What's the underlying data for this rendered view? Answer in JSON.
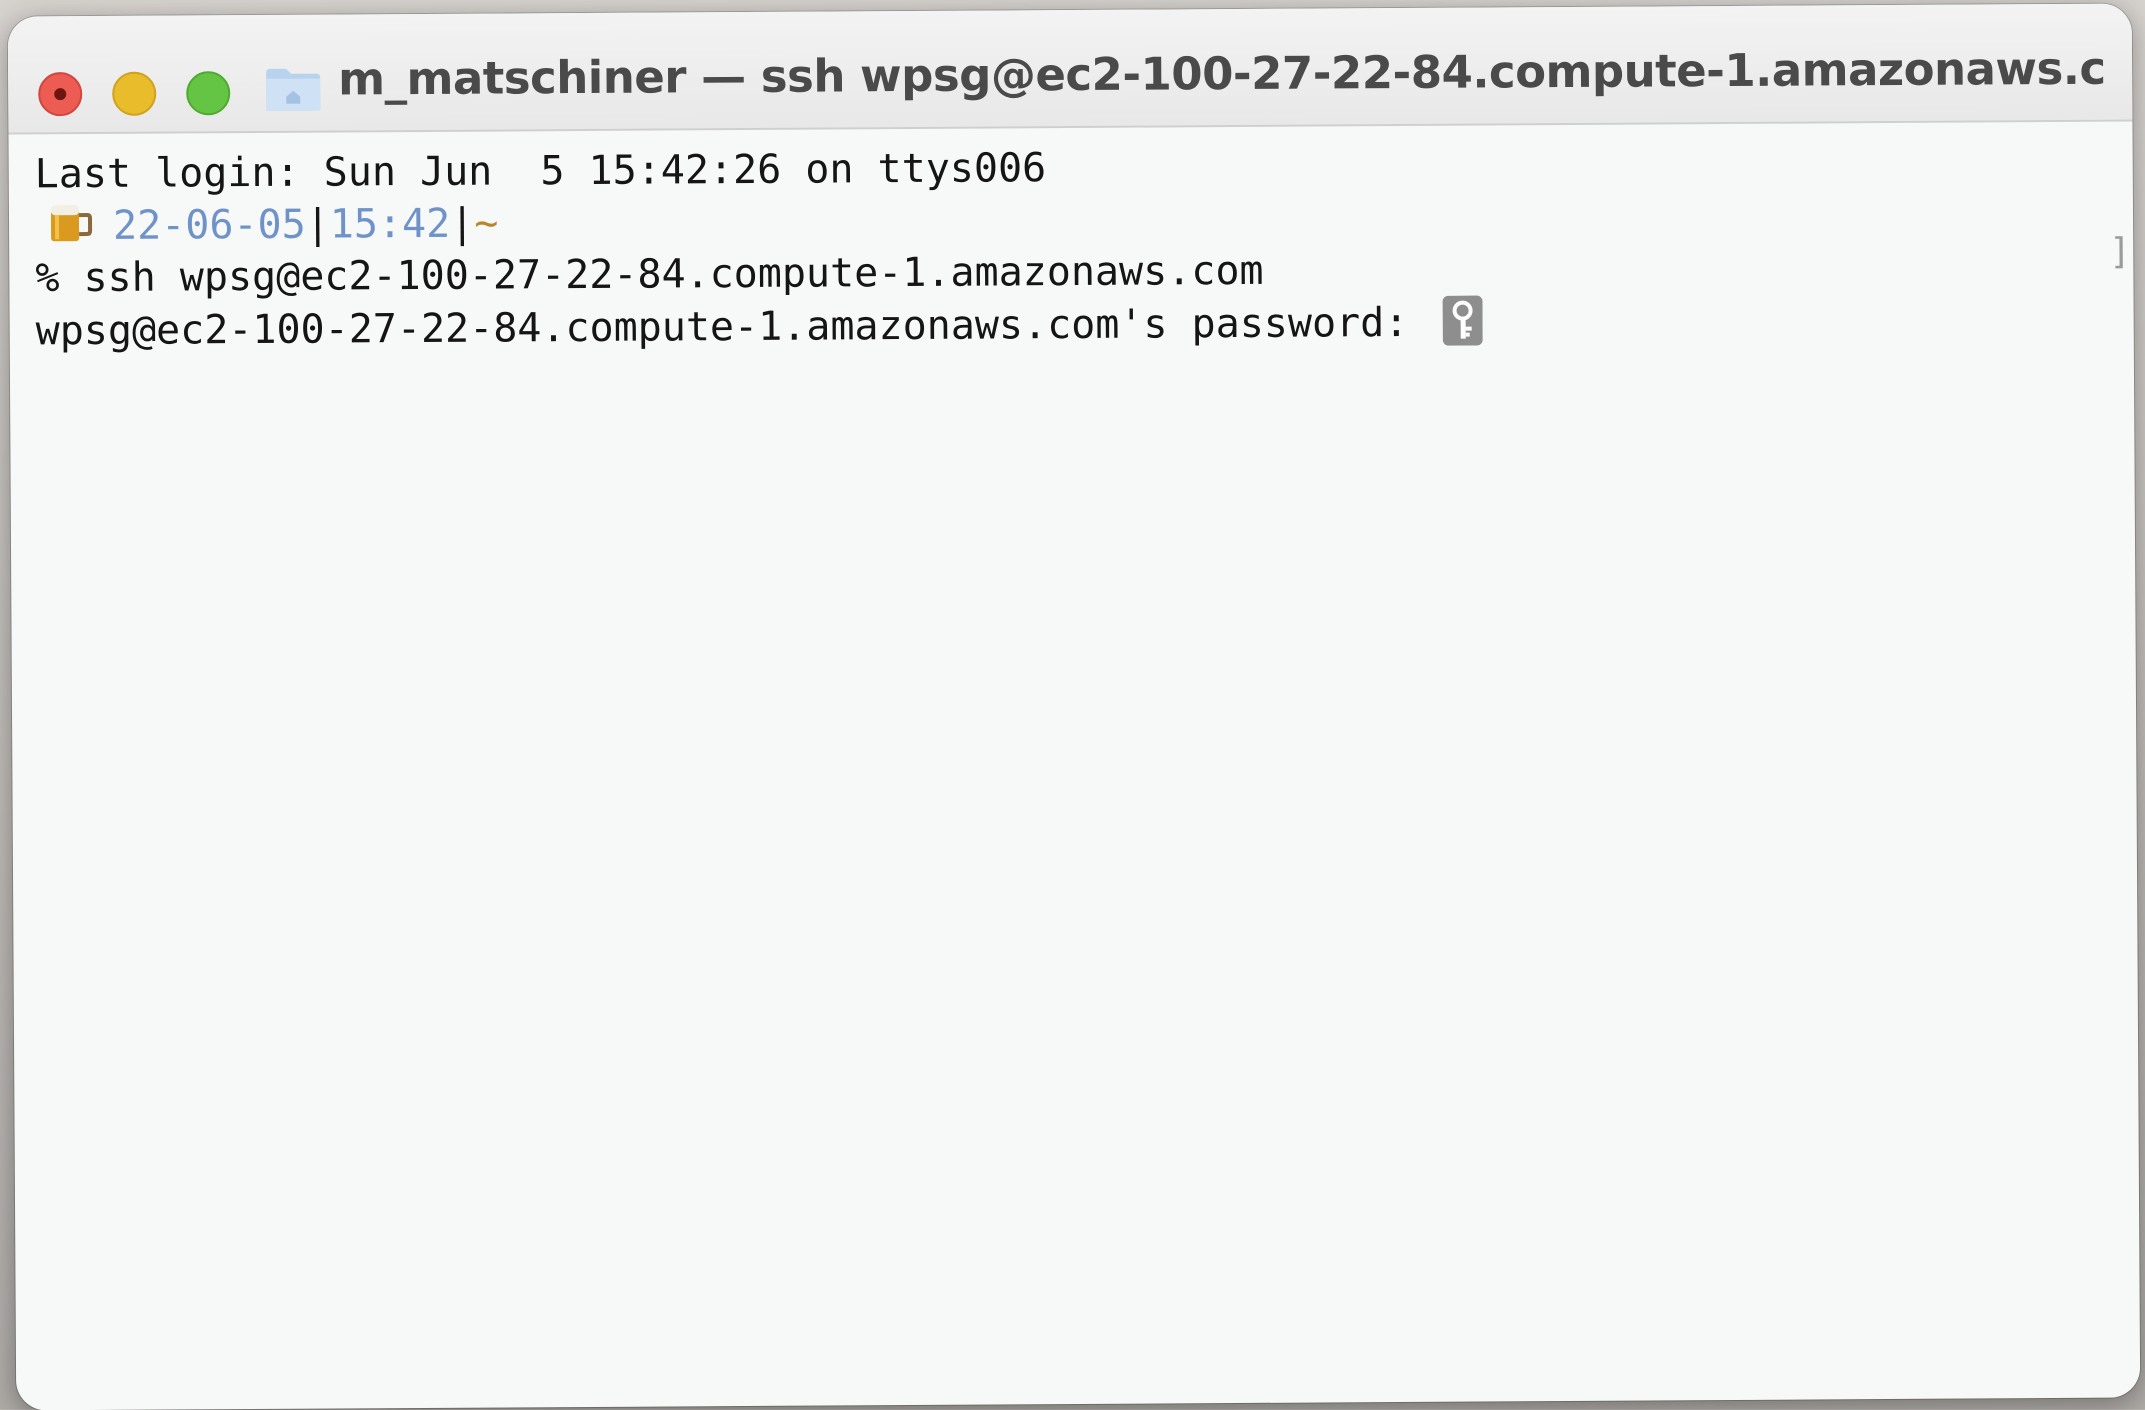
{
  "window": {
    "title": "m_matschiner — ssh wpsg@ec2-100-27-22-84.compute-1.amazonaws.c..."
  },
  "terminal": {
    "last_login": "Last login: Sun Jun  5 15:42:26 on ttys006",
    "prompt": {
      "date": "22-06-05",
      "separator": "|",
      "time": "15:42",
      "separator2": "|",
      "path": "~"
    },
    "command_line": "% ssh wpsg@ec2-100-27-22-84.compute-1.amazonaws.com",
    "password_prompt": "wpsg@ec2-100-27-22-84.compute-1.amazonaws.com's password: "
  },
  "icons": {
    "prompt_icon": "beer-mug-icon",
    "password_icon": "key-icon",
    "title_icon": "home-folder-icon"
  },
  "colors": {
    "close": "#ec5c53",
    "minimize": "#e8bc2a",
    "maximize": "#64c443",
    "prompt_date": "#6f93c9",
    "prompt_path": "#b8862b"
  }
}
